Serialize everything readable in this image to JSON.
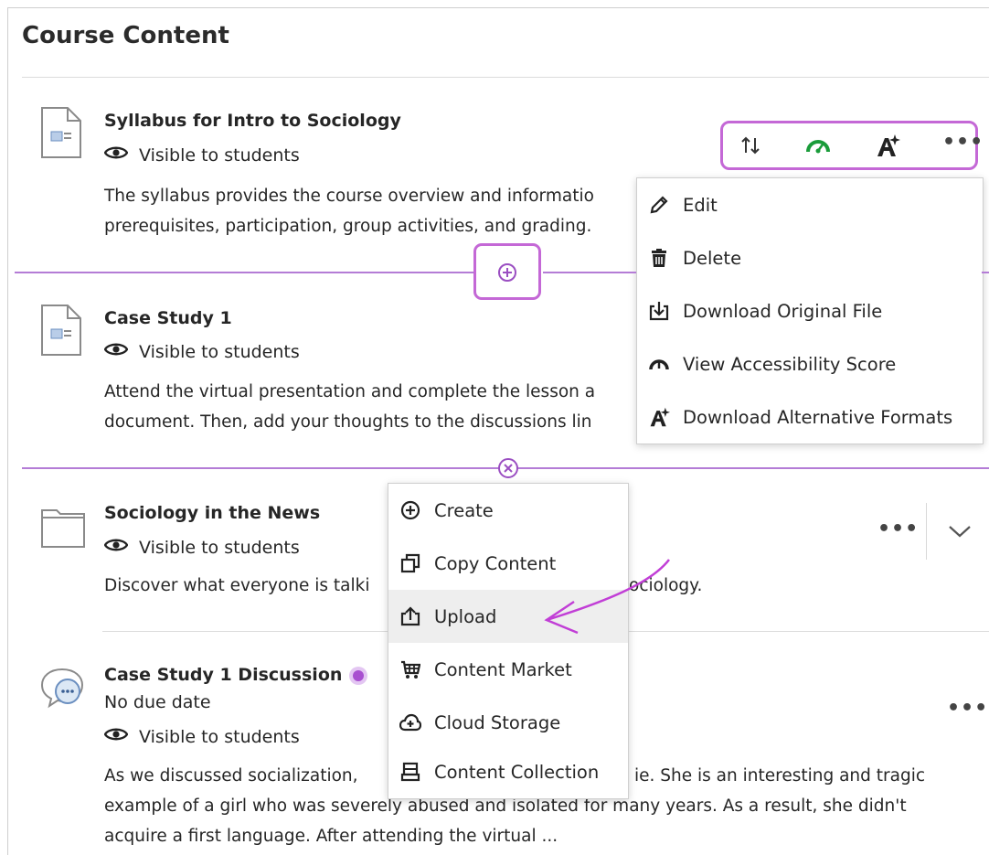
{
  "page_title": "Course Content",
  "items": [
    {
      "title": "Syllabus for Intro to Sociology",
      "visibility": "Visible to students",
      "desc_line1": "The syllabus provides the course overview and informatio",
      "desc_line2": "prerequisites, participation, group activities, and grading.",
      "icon": "document-icon"
    },
    {
      "title": "Case Study 1",
      "visibility": "Visible to students",
      "desc_line1": "Attend the virtual presentation and complete the lesson a",
      "desc_line2": "document. Then, add your thoughts to the discussions lin",
      "icon": "document-icon"
    },
    {
      "title": "Sociology in the News",
      "visibility": "Visible to students",
      "desc_left": "Discover what everyone is talki",
      "desc_right": "ociology.",
      "icon": "folder-icon"
    },
    {
      "title": "Case Study 1 Discussion",
      "due": "No due date",
      "visibility": "Visible to students",
      "desc_left": "As we discussed socialization,",
      "desc_right": "ie. She is an interesting and tragic",
      "desc_line2": "example of a girl who was severely abused and isolated for many years. As a result, she didn't",
      "desc_line3": "acquire a first language. After attending the virtual ...",
      "icon": "discussion-icon"
    }
  ],
  "item_menu": [
    {
      "label": "Edit",
      "icon": "pencil-icon"
    },
    {
      "label": "Delete",
      "icon": "trash-icon"
    },
    {
      "label": "Download Original File",
      "icon": "download-icon"
    },
    {
      "label": "View Accessibility Score",
      "icon": "gauge-icon"
    },
    {
      "label": "Download Alternative Formats",
      "icon": "alternative-formats-icon"
    }
  ],
  "add_menu": [
    {
      "label": "Create",
      "icon": "plus-circle-icon"
    },
    {
      "label": "Copy Content",
      "icon": "copy-icon"
    },
    {
      "label": "Upload",
      "icon": "upload-icon"
    },
    {
      "label": "Content Market",
      "icon": "cart-icon"
    },
    {
      "label": "Cloud Storage",
      "icon": "cloud-icon"
    },
    {
      "label": "Content Collection",
      "icon": "collection-icon"
    }
  ],
  "colors": {
    "accent": "#b47cd6",
    "highlight_border": "#c468d6",
    "gauge_green": "#1a9c3a"
  }
}
